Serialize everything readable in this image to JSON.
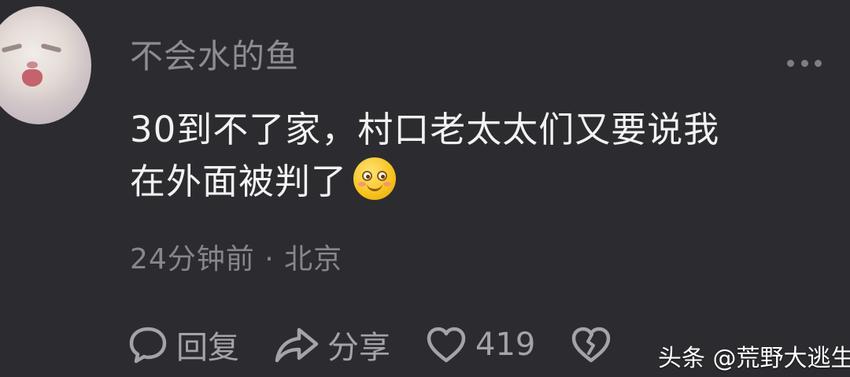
{
  "comment": {
    "username": "不会水的鱼",
    "text_line1": "30到不了家，村口老太太们又要说我",
    "text_line2": "在外面被判了",
    "emoji": "smiling-face-emoji",
    "time": "24分钟前",
    "separator": "·",
    "location": "北京"
  },
  "actions": {
    "reply_label": "回复",
    "share_label": "分享",
    "like_count": "419"
  },
  "watermark": {
    "text": "头条 @荒野大逃生"
  },
  "colors": {
    "background": "#2c2c30",
    "primary_text": "#f2f2f2",
    "secondary_text": "#8c8c92"
  }
}
